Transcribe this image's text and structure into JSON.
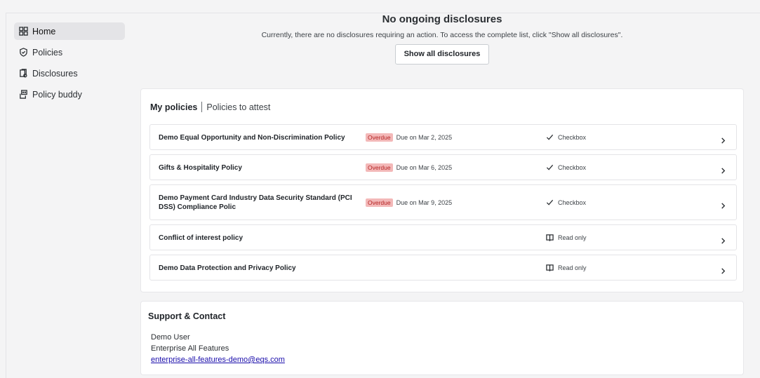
{
  "sidebar": {
    "items": [
      {
        "label": "Home",
        "icon": "grid-icon",
        "active": true
      },
      {
        "label": "Policies",
        "icon": "shield-check-icon"
      },
      {
        "label": "Disclosures",
        "icon": "document-stack-icon"
      },
      {
        "label": "Policy buddy",
        "icon": "bot-icon"
      }
    ]
  },
  "banner": {
    "title": "No ongoing disclosures",
    "subtitle": "Currently, there are no disclosures requiring an action. To access the complete list, click \"Show all disclosures\".",
    "button_label": "Show all disclosures"
  },
  "policies": {
    "tab_active": "My policies",
    "tab_other": "Policies to attest",
    "rows": [
      {
        "name": "Demo Equal Opportunity and Non-Discrimination Policy",
        "badge": "Overdue",
        "due": "Due on Mar 2, 2025",
        "type": "Checkbox",
        "type_icon": "check-icon"
      },
      {
        "name": "Gifts & Hospitality Policy",
        "badge": "Overdue",
        "due": "Due on Mar 6, 2025",
        "type": "Checkbox",
        "type_icon": "check-icon"
      },
      {
        "name": "Demo Payment Card Industry Data Security Standard (PCI DSS) Compliance Polic",
        "badge": "Overdue",
        "due": "Due on Mar 9, 2025",
        "type": "Checkbox",
        "type_icon": "check-icon"
      },
      {
        "name": "Conflict of interest policy",
        "badge": "",
        "due": "",
        "type": "Read only",
        "type_icon": "book-icon"
      },
      {
        "name": "Demo Data Protection and Privacy Policy",
        "badge": "",
        "due": "",
        "type": "Read only",
        "type_icon": "book-icon"
      }
    ]
  },
  "support": {
    "title": "Support & Contact",
    "user": "Demo User",
    "company": "Enterprise All Features",
    "email": "enterprise-all-features-demo@eqs.com"
  },
  "colors": {
    "overdue_bg": "#f3b8b8",
    "overdue_text": "#b42323",
    "link": "#1a0dab"
  }
}
